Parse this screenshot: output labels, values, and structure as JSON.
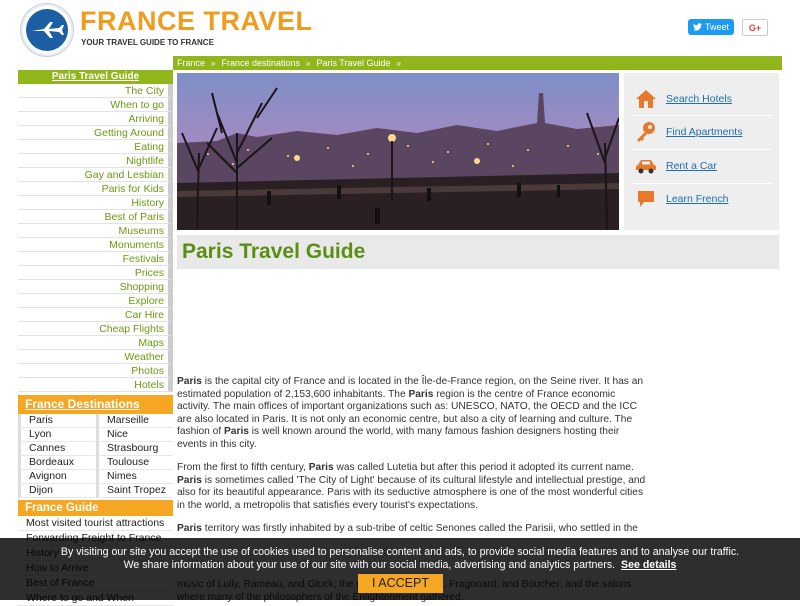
{
  "header": {
    "title": "FRANCE TRAVEL",
    "tagline": "YOUR TRAVEL GUIDE TO FRANCE",
    "tweet_label": "Tweet",
    "gplus_label": "G+"
  },
  "breadcrumb": {
    "items": [
      "France",
      "France destinations",
      "Paris Travel Guide"
    ],
    "separator": "»"
  },
  "sidebar": {
    "guide_heading": "Paris Travel Guide",
    "guide_items": [
      "The City",
      "When to go",
      "Arriving",
      "Getting Around",
      "Eating",
      "Nightlife",
      "Gay and Lesbian",
      "Paris for Kids",
      "History",
      "Best of Paris",
      "Museums",
      "Monuments",
      "Festivals",
      "Prices",
      "Shopping",
      "Explore",
      "Car Hire",
      "Cheap Flights",
      "Maps",
      "Weather",
      "Photos",
      "Hotels"
    ],
    "destinations_heading": "France Destinations",
    "destinations": [
      "Paris",
      "Marseille",
      "Lyon",
      "Nice",
      "Cannes",
      "Strasbourg",
      "Bordeaux",
      "Toulouse",
      "Avignon",
      "Nimes",
      "Dijon",
      "Saint Tropez"
    ],
    "france_guide_heading": "France Guide",
    "france_guide_items": [
      "Most visited tourist attractions",
      "Forwarding Freight to France",
      "History",
      "How to Arrive",
      "Best of France",
      "Where to go and When"
    ]
  },
  "quick_links": [
    {
      "label": "Search Hotels",
      "icon": "house-icon"
    },
    {
      "label": "Find Apartments",
      "icon": "key-icon"
    },
    {
      "label": "Rent a Car",
      "icon": "car-icon"
    },
    {
      "label": "Learn French",
      "icon": "speech-bubble-icon"
    }
  ],
  "page_title": "Paris Travel Guide",
  "article": {
    "p1": {
      "a": "Paris",
      "b": " is the capital city of France and is located in the Île-de-France region, on the Seine river. It has an estimated population of 2,153,600 inhabitants. The ",
      "c": "Paris",
      "d": " region is the centre of France economic activity. The main offices of important organizations such as: UNESCO, NATO, the OECD and the ICC are also located in Paris. It is not only an economic centre, but also a city of learning and culture. The fashion of ",
      "e": "Paris",
      "f": " is well known around the world, with many famous fashion designers hosting their events in this city."
    },
    "p2": {
      "a": "From the first to fifth century, ",
      "b": "Paris",
      "c": " was called Lutetia but after this period it adopted its current name. ",
      "d": "Paris",
      "e": " is sometimes called 'The City of Light' because of its cultural lifestyle and intellectual prestige, and also for its beautiful appearance. Paris with its seductive atmosphere is one of the most wonderful cities in the world, a metropolis that satisfies every tourist's expectations."
    },
    "p3": {
      "a": "Paris",
      "b": " territory was firstly inhabited by a sub-tribe of celtic Senones called the Parisii, who settled in the"
    },
    "p4": "music of Lully, Rameau, and Gluck; the painting of Boucher, Fragonard, and Boucher; and the salons where many of the philosophers of the Enlightenment gathered."
  },
  "cookie_banner": {
    "line1": "By visiting our site you accept the use of cookies used to personalise content and ads, to provide social media features and to analyse our traffic.",
    "line2": "We share information about your use of our site with our social media, advertising and analytics partners.",
    "more_link": "See details",
    "accept_label": "I ACCEPT"
  },
  "colors": {
    "brand_orange": "#f5a623",
    "brand_green": "#90b61c",
    "link_blue": "#1d6fb0"
  }
}
